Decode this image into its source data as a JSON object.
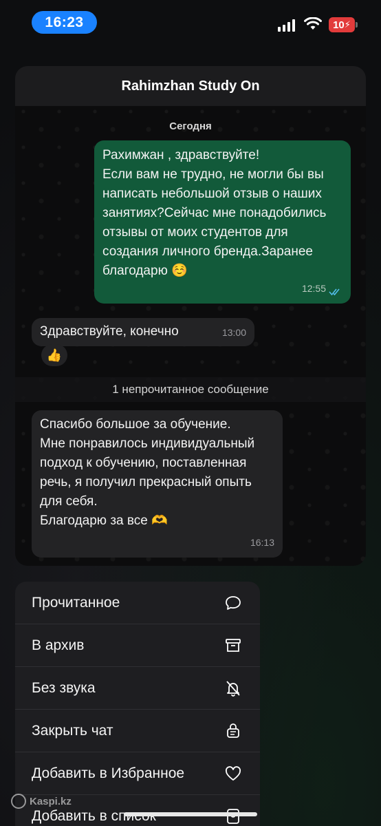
{
  "status_bar": {
    "time": "16:23",
    "battery": "10"
  },
  "chat": {
    "title": "Rahimzhan Study On",
    "date_label": "Сегодня",
    "unread_banner": "1 непрочитанное сообщение",
    "messages": [
      {
        "direction": "outgoing",
        "text": "Рахимжан , здравствуйте!\nЕсли вам не трудно, не могли бы вы написать небольшой отзыв о наших занятиях?Сейчас мне понадобились отзывы от моих студентов для создания личного бренда.Заранее благодарю ☺️",
        "time": "12:55",
        "status": "read"
      },
      {
        "direction": "incoming",
        "text": "Здравствуйте, конечно",
        "time": "13:00",
        "reaction": "👍"
      },
      {
        "direction": "incoming",
        "text": "Спасибо большое за обучение.\nМне понравилось индивидуальный подход к обучению, поставленная речь, я получил прекрасный опыть для себя.\nБлагодарю за все 🫶",
        "time": "16:13"
      }
    ]
  },
  "context_menu": {
    "items": [
      {
        "label": "Прочитанное",
        "icon": "chat-bubble-icon"
      },
      {
        "label": "В архив",
        "icon": "archive-icon"
      },
      {
        "label": "Без звука",
        "icon": "bell-off-icon"
      },
      {
        "label": "Закрыть чат",
        "icon": "lock-chat-icon"
      },
      {
        "label": "Добавить в Избранное",
        "icon": "heart-icon"
      },
      {
        "label": "Добавить в список",
        "icon": "list-add-icon"
      }
    ]
  },
  "watermark": "Kaspi.kz",
  "colors": {
    "accent_blue": "#1a82ff",
    "outgoing_bubble": "#125a3a",
    "incoming_bubble": "#232325",
    "read_ticks": "#53bdeb",
    "battery_low": "#e23b3b"
  }
}
